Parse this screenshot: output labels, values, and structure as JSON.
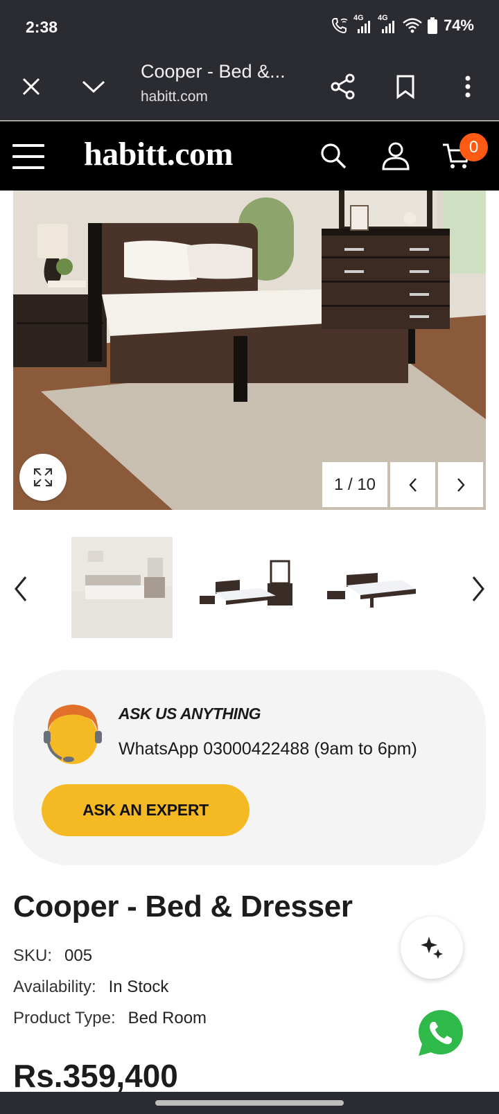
{
  "status_bar": {
    "time": "2:38",
    "network_1": "4G",
    "network_2": "4G",
    "battery": "74%"
  },
  "browser": {
    "title": "Cooper - Bed &...",
    "url": "habitt.com",
    "icons": [
      "close-icon",
      "chevron-down-icon",
      "share-icon",
      "bookmark-icon",
      "more-vert-icon"
    ]
  },
  "site_header": {
    "logo": "habitt.com",
    "cart_count": "0",
    "icons": [
      "menu-icon",
      "search-icon",
      "account-icon",
      "cart-icon"
    ]
  },
  "gallery": {
    "counter": "1 / 10",
    "current_index": 1,
    "total": 10,
    "icons": [
      "expand-icon",
      "chevron-left-icon",
      "chevron-right-icon"
    ]
  },
  "ask_card": {
    "title": "ASK US ANYTHING",
    "line": "WhatsApp 03000422488 (9am to 6pm)",
    "button": "ASK AN EXPERT"
  },
  "product": {
    "title": "Cooper - Bed & Dresser",
    "sku_label": "SKU:",
    "sku_value": "005",
    "availability_label": "Availability:",
    "availability_value": "In Stock",
    "type_label": "Product Type:",
    "type_value": "Bed Room",
    "price": "Rs.359,400"
  },
  "colors": {
    "chrome": "#2b2c31",
    "header": "#000000",
    "accent_button": "#f5b923",
    "badge": "#ff5a14",
    "whatsapp": "#2fb94a"
  }
}
